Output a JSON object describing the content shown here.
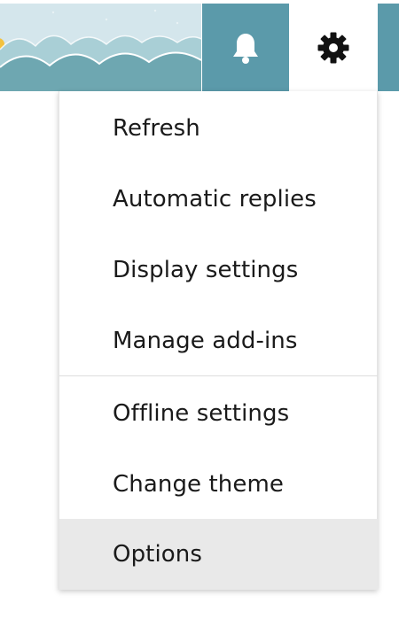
{
  "header": {
    "banner_colors": {
      "sky": "#cfe2ea",
      "sea": "#6ea7b1",
      "foam": "#ffffff",
      "sun": "#f3c23f"
    },
    "bell_button": {
      "icon": "bell-icon",
      "background": "#5b9aaa"
    },
    "settings_button": {
      "icon": "gear-icon",
      "background": "#ffffff",
      "active": true
    }
  },
  "settings_menu": {
    "group1": [
      {
        "label": "Refresh"
      },
      {
        "label": "Automatic replies"
      },
      {
        "label": "Display settings"
      },
      {
        "label": "Manage add-ins"
      }
    ],
    "group2": [
      {
        "label": "Offline settings"
      },
      {
        "label": "Change theme"
      },
      {
        "label": "Options",
        "highlighted": true
      }
    ]
  }
}
